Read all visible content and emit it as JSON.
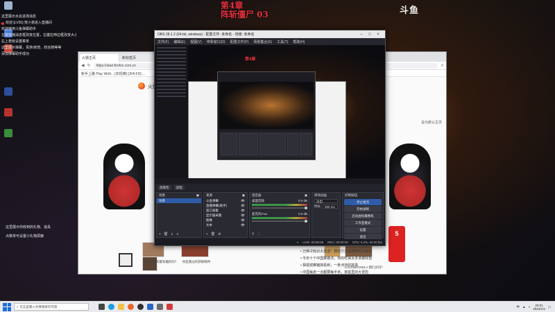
{
  "overlay": {
    "title_line1": "第4章",
    "title_line2": "阵斩僵尸 03",
    "brand": "斗鱼",
    "left_messages": [
      "这里展示水友进场消息",
      "欢迎 [LV35] 荒小弟进入直播间",
      "",
      "欢迎使用斗鱼弹幕助手",
      "左键拖拽消息框改变位置，左键拉伸边框改变大小",
      "右上角有设置菜单",
      "这里展示弹幕，贵族/房管，粉丝牌等等",
      "添加弹幕助手成功"
    ],
    "gift_messages": [
      "这里展示你收到的礼物、道具",
      "点菜单可设置小礼物屏蔽"
    ]
  },
  "browser": {
    "tabs": [
      "火狐主页",
      "新标签页"
    ],
    "url": "https://start.firefox.com.cn",
    "bookmarks": "新手上路  Play Wrld...  [本机推]  [JFA FD]  ...",
    "brand_text": "火狐",
    "set_home": "设为默认主页",
    "news": [
      "• 万种冷知识大放送！那些万万没想到的冷知识",
      "• 今天十个中国菜做法，你的吃得太多该被收拾",
      "• 相视观察猪掉看到，一条河流的故事",
      "• 中国每走一点都要每半米，家庭里的大冒险"
    ],
    "captions": [
      "你是看过的最有趣的吗？",
      "你是看过的新鲜物件",
      "LUCKBEONDLA 我们买吗？"
    ]
  },
  "obs": {
    "title": "OBS 28.1.2 (64-bit, windows) - 配置文件: 未命名 - 场景: 未命名",
    "menu": [
      "文件(F)",
      "编辑(E)",
      "视图(V)",
      "停靠窗口(D)",
      "配置文件(P)",
      "场景集合(S)",
      "工具(T)",
      "帮助(H)"
    ],
    "source_bar": [
      "源属性",
      "滤镜"
    ],
    "docks": {
      "scenes": {
        "header": "场景",
        "items": [
          "场景"
        ]
      },
      "sources": {
        "header": "来源",
        "items": [
          "斗鱼弹幕",
          "直播弹幕(助手)",
          "窗口采集",
          "显示器采集",
          "图像",
          "文本"
        ]
      },
      "mixer": {
        "header": "混音器",
        "channels": [
          {
            "name": "桌面音频",
            "db": "0.0 dB"
          },
          {
            "name": "麦克风/Aux",
            "db": "0.0 dB"
          }
        ]
      },
      "transitions": {
        "header": "转场动画",
        "type": "淡出",
        "duration_label": "时长",
        "duration": "300 ms"
      },
      "controls": {
        "header": "控制按钮",
        "buttons": [
          "停止推流",
          "开始录制",
          "启动虚拟摄像机",
          "工作室模式",
          "设置",
          "退出"
        ]
      }
    },
    "status": {
      "live": "LIVE: 00:08:09",
      "rec": "REC: 00:00:00",
      "cpu": "CPU: 5.2%, 60.00 fps"
    }
  },
  "taskbar": {
    "search_placeholder": "在这里输入你要搜索的内容",
    "time": "20:01",
    "date": "2023/1/3",
    "lang": "中"
  }
}
